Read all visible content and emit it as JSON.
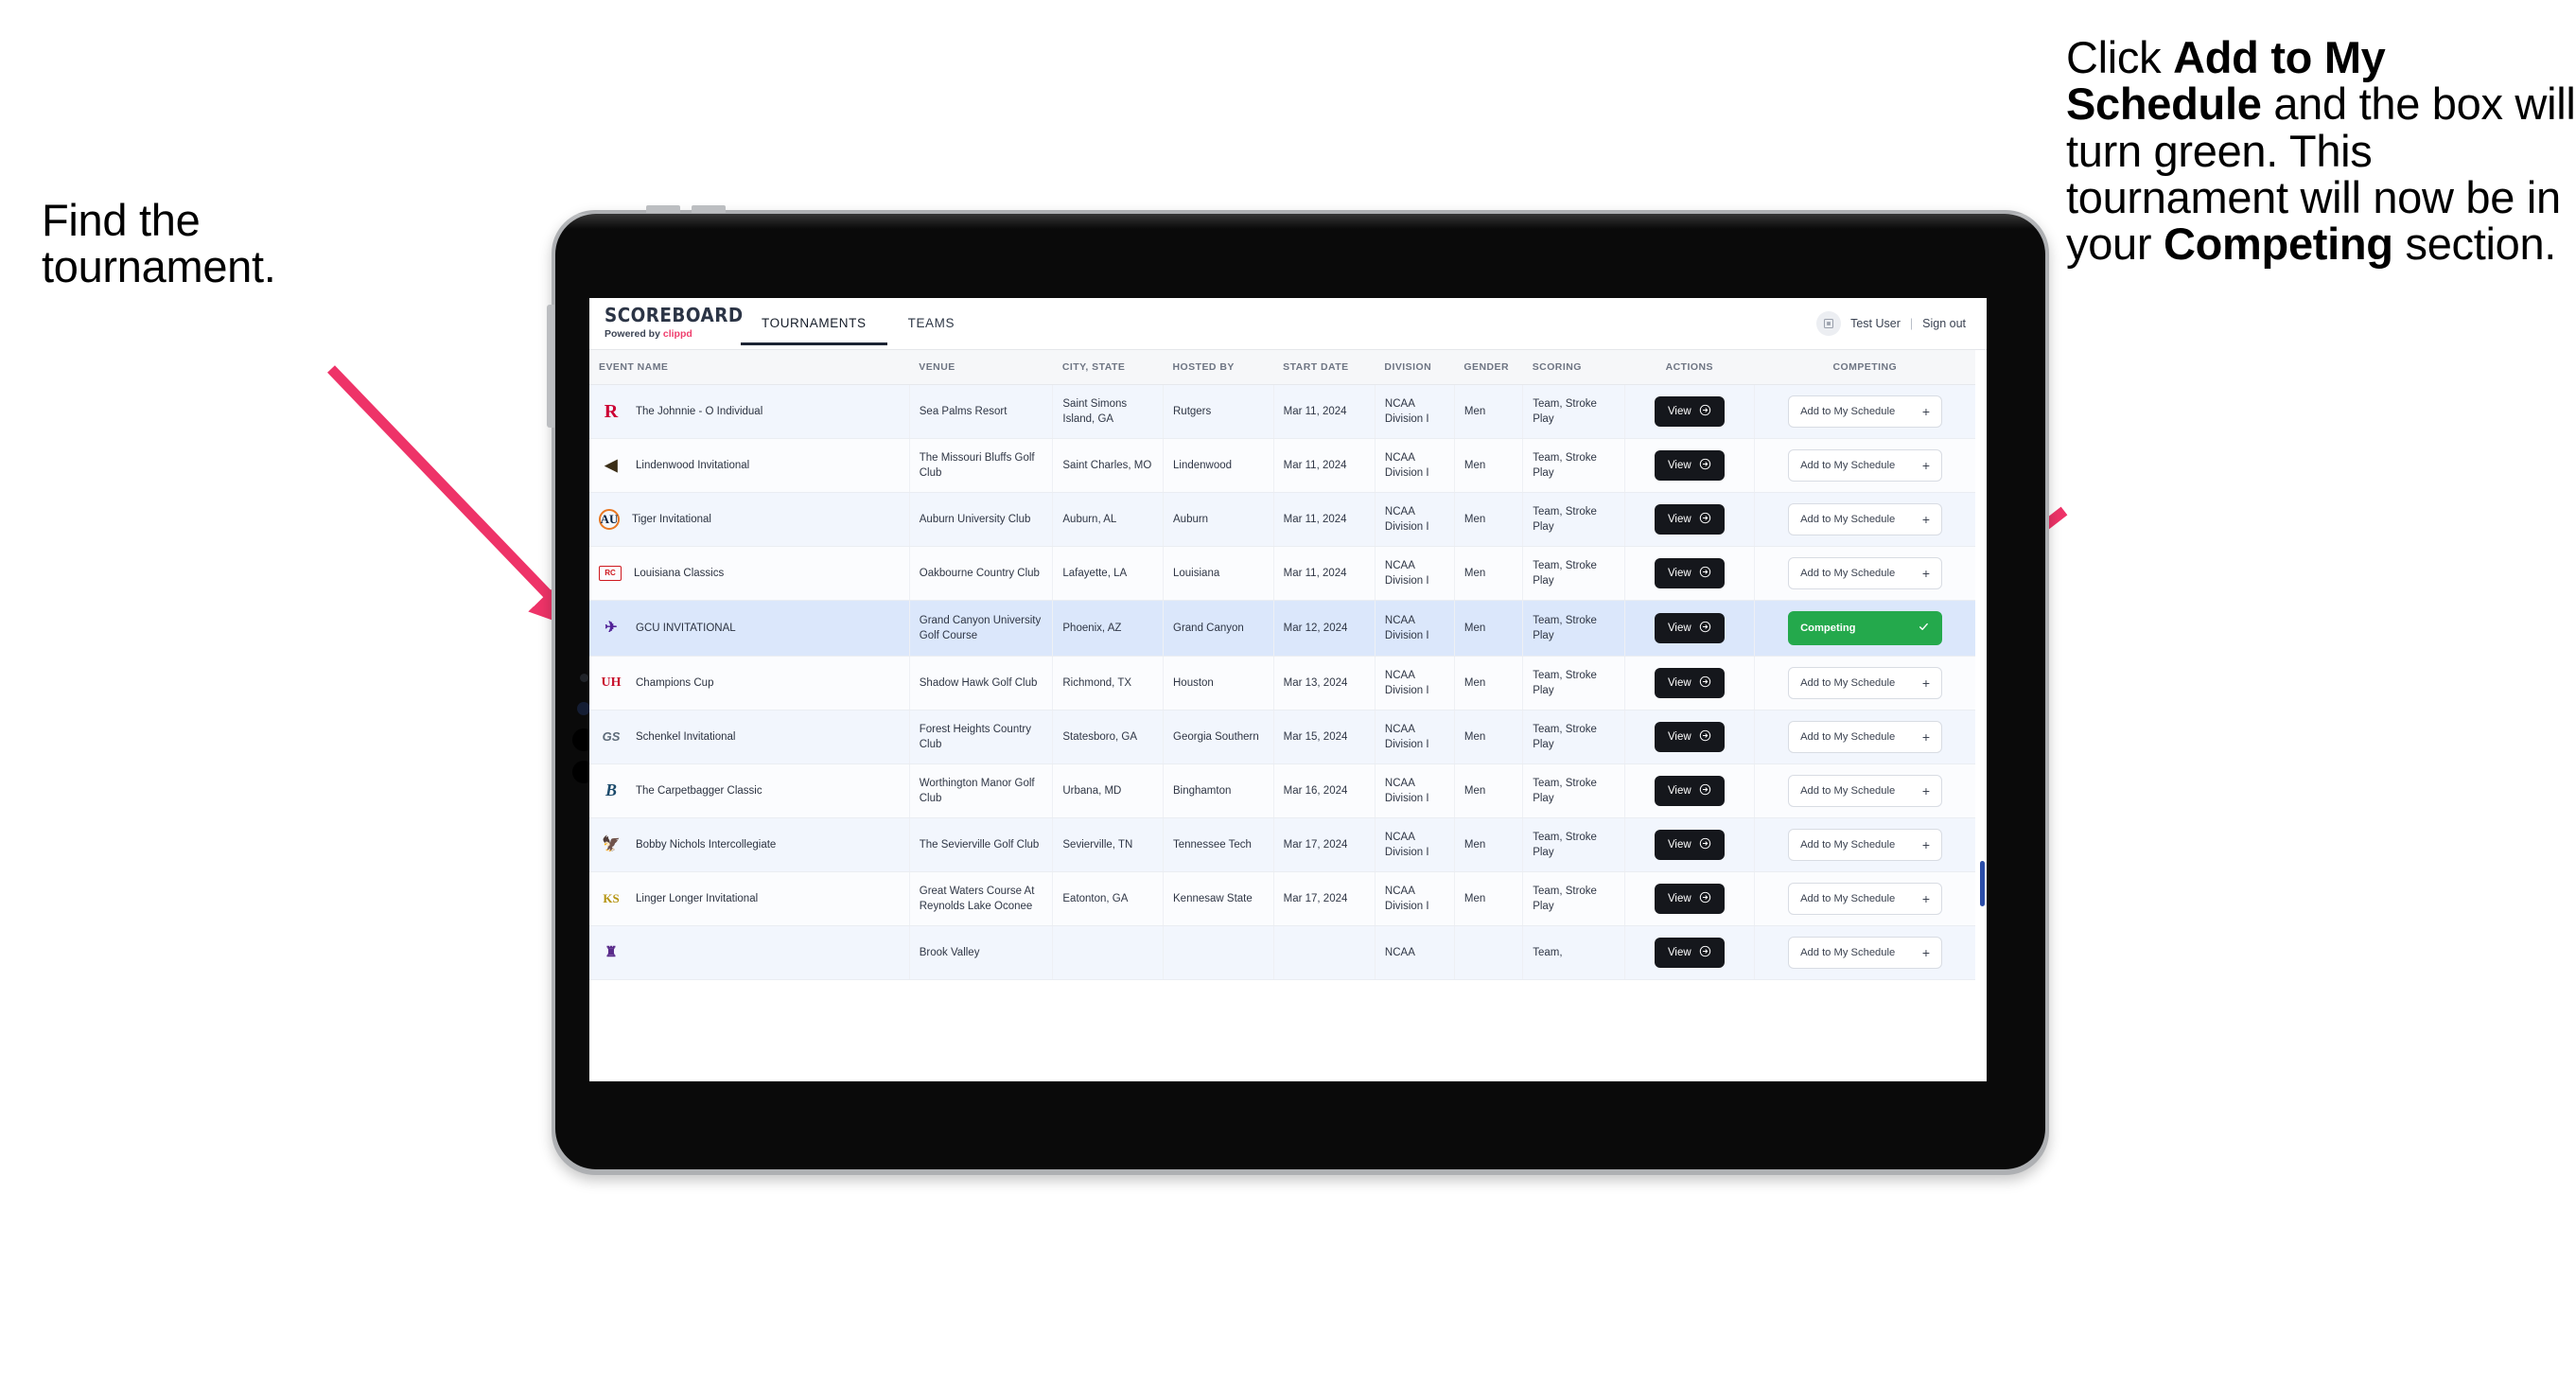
{
  "annotations": {
    "left": {
      "lines": [
        "Find the",
        "tournament."
      ]
    },
    "right": {
      "segments": [
        {
          "t": "Click ",
          "b": false
        },
        {
          "t": "Add to My Schedule",
          "b": true
        },
        {
          "t": " and the box will turn green. This tournament will now be in your ",
          "b": false
        },
        {
          "t": "Competing",
          "b": true
        },
        {
          "t": " section.",
          "b": false
        }
      ]
    }
  },
  "app": {
    "brand": {
      "name": "SCOREBOARD",
      "powered_prefix": "Powered by ",
      "powered_brand": "clippd"
    },
    "tabs": [
      {
        "label": "TOURNAMENTS",
        "active": true
      },
      {
        "label": "TEAMS",
        "active": false
      }
    ],
    "account": {
      "avatar_icon": "user-square-icon",
      "user": "Test User",
      "separator": "|",
      "signout": "Sign out"
    },
    "table": {
      "columns": [
        "EVENT NAME",
        "VENUE",
        "CITY, STATE",
        "HOSTED BY",
        "START DATE",
        "DIVISION",
        "GENDER",
        "SCORING",
        "ACTIONS",
        "COMPETING"
      ],
      "view_label": "View",
      "add_label": "Add to My Schedule",
      "add_icon": "plus-icon",
      "competing_label": "Competing",
      "competing_icon": "check-icon",
      "view_icon": "arrow-right-circle-icon",
      "rows": [
        {
          "logo": "rutgers-logo",
          "event": "The Johnnie - O Individual",
          "venue": "Sea Palms Resort",
          "city": "Saint Simons Island, GA",
          "host": "Rutgers",
          "date": "Mar 11, 2024",
          "division": "NCAA Division I",
          "gender": "Men",
          "scoring": "Team, Stroke Play",
          "competing": false,
          "selected": false
        },
        {
          "logo": "lindenwood-logo",
          "event": "Lindenwood Invitational",
          "venue": "The Missouri Bluffs Golf Club",
          "city": "Saint Charles, MO",
          "host": "Lindenwood",
          "date": "Mar 11, 2024",
          "division": "NCAA Division I",
          "gender": "Men",
          "scoring": "Team, Stroke Play",
          "competing": false,
          "selected": false
        },
        {
          "logo": "auburn-logo",
          "event": "Tiger Invitational",
          "venue": "Auburn University Club",
          "city": "Auburn, AL",
          "host": "Auburn",
          "date": "Mar 11, 2024",
          "division": "NCAA Division I",
          "gender": "Men",
          "scoring": "Team, Stroke Play",
          "competing": false,
          "selected": false
        },
        {
          "logo": "louisiana-logo",
          "event": "Louisiana Classics",
          "venue": "Oakbourne Country Club",
          "city": "Lafayette, LA",
          "host": "Louisiana",
          "date": "Mar 11, 2024",
          "division": "NCAA Division I",
          "gender": "Men",
          "scoring": "Team, Stroke Play",
          "competing": false,
          "selected": false
        },
        {
          "logo": "gcu-logo",
          "event": "GCU INVITATIONAL",
          "venue": "Grand Canyon University Golf Course",
          "city": "Phoenix, AZ",
          "host": "Grand Canyon",
          "date": "Mar 12, 2024",
          "division": "NCAA Division I",
          "gender": "Men",
          "scoring": "Team, Stroke Play",
          "competing": true,
          "selected": true
        },
        {
          "logo": "houston-logo",
          "event": "Champions Cup",
          "venue": "Shadow Hawk Golf Club",
          "city": "Richmond, TX",
          "host": "Houston",
          "date": "Mar 13, 2024",
          "division": "NCAA Division I",
          "gender": "Men",
          "scoring": "Team, Stroke Play",
          "competing": false,
          "selected": false
        },
        {
          "logo": "georgia-southern-logo",
          "event": "Schenkel Invitational",
          "venue": "Forest Heights Country Club",
          "city": "Statesboro, GA",
          "host": "Georgia Southern",
          "date": "Mar 15, 2024",
          "division": "NCAA Division I",
          "gender": "Men",
          "scoring": "Team, Stroke Play",
          "competing": false,
          "selected": false
        },
        {
          "logo": "binghamton-logo",
          "event": "The Carpetbagger Classic",
          "venue": "Worthington Manor Golf Club",
          "city": "Urbana, MD",
          "host": "Binghamton",
          "date": "Mar 16, 2024",
          "division": "NCAA Division I",
          "gender": "Men",
          "scoring": "Team, Stroke Play",
          "competing": false,
          "selected": false
        },
        {
          "logo": "tennessee-tech-logo",
          "event": "Bobby Nichols Intercollegiate",
          "venue": "The Sevierville Golf Club",
          "city": "Sevierville, TN",
          "host": "Tennessee Tech",
          "date": "Mar 17, 2024",
          "division": "NCAA Division I",
          "gender": "Men",
          "scoring": "Team, Stroke Play",
          "competing": false,
          "selected": false
        },
        {
          "logo": "kennesaw-state-logo",
          "event": "Linger Longer Invitational",
          "venue": "Great Waters Course At Reynolds Lake Oconee",
          "city": "Eatonton, GA",
          "host": "Kennesaw State",
          "date": "Mar 17, 2024",
          "division": "NCAA Division I",
          "gender": "Men",
          "scoring": "Team, Stroke Play",
          "competing": false,
          "selected": false
        },
        {
          "logo": "ecu-logo",
          "event": "",
          "venue": "Brook Valley",
          "city": "",
          "host": "",
          "date": "",
          "division": "NCAA",
          "gender": "",
          "scoring": "Team,",
          "competing": false,
          "selected": false
        }
      ]
    }
  },
  "colors": {
    "accent_pink": "#ef3e6d",
    "competing_green": "#24a94c",
    "dark_button": "#15171c",
    "selected_row": "#dbe7fb",
    "arrow_pink": "#ee3368"
  }
}
